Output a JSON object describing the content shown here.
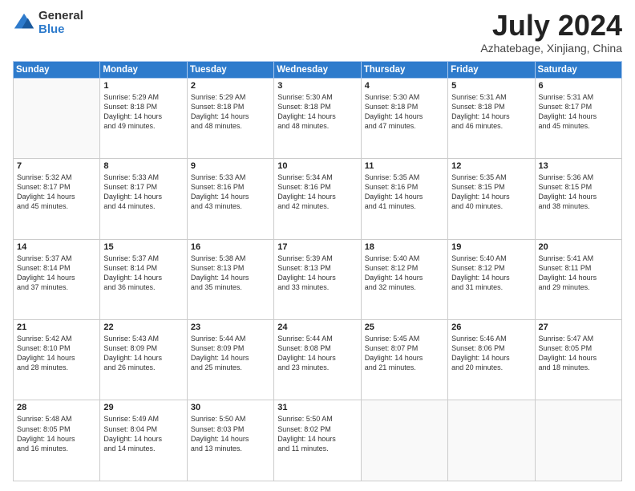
{
  "logo": {
    "general": "General",
    "blue": "Blue"
  },
  "title": {
    "month_year": "July 2024",
    "location": "Azhatebage, Xinjiang, China"
  },
  "weekdays": [
    "Sunday",
    "Monday",
    "Tuesday",
    "Wednesday",
    "Thursday",
    "Friday",
    "Saturday"
  ],
  "weeks": [
    [
      {
        "day": "",
        "info": ""
      },
      {
        "day": "1",
        "info": "Sunrise: 5:29 AM\nSunset: 8:18 PM\nDaylight: 14 hours\nand 49 minutes."
      },
      {
        "day": "2",
        "info": "Sunrise: 5:29 AM\nSunset: 8:18 PM\nDaylight: 14 hours\nand 48 minutes."
      },
      {
        "day": "3",
        "info": "Sunrise: 5:30 AM\nSunset: 8:18 PM\nDaylight: 14 hours\nand 48 minutes."
      },
      {
        "day": "4",
        "info": "Sunrise: 5:30 AM\nSunset: 8:18 PM\nDaylight: 14 hours\nand 47 minutes."
      },
      {
        "day": "5",
        "info": "Sunrise: 5:31 AM\nSunset: 8:18 PM\nDaylight: 14 hours\nand 46 minutes."
      },
      {
        "day": "6",
        "info": "Sunrise: 5:31 AM\nSunset: 8:17 PM\nDaylight: 14 hours\nand 45 minutes."
      }
    ],
    [
      {
        "day": "7",
        "info": "Sunrise: 5:32 AM\nSunset: 8:17 PM\nDaylight: 14 hours\nand 45 minutes."
      },
      {
        "day": "8",
        "info": "Sunrise: 5:33 AM\nSunset: 8:17 PM\nDaylight: 14 hours\nand 44 minutes."
      },
      {
        "day": "9",
        "info": "Sunrise: 5:33 AM\nSunset: 8:16 PM\nDaylight: 14 hours\nand 43 minutes."
      },
      {
        "day": "10",
        "info": "Sunrise: 5:34 AM\nSunset: 8:16 PM\nDaylight: 14 hours\nand 42 minutes."
      },
      {
        "day": "11",
        "info": "Sunrise: 5:35 AM\nSunset: 8:16 PM\nDaylight: 14 hours\nand 41 minutes."
      },
      {
        "day": "12",
        "info": "Sunrise: 5:35 AM\nSunset: 8:15 PM\nDaylight: 14 hours\nand 40 minutes."
      },
      {
        "day": "13",
        "info": "Sunrise: 5:36 AM\nSunset: 8:15 PM\nDaylight: 14 hours\nand 38 minutes."
      }
    ],
    [
      {
        "day": "14",
        "info": "Sunrise: 5:37 AM\nSunset: 8:14 PM\nDaylight: 14 hours\nand 37 minutes."
      },
      {
        "day": "15",
        "info": "Sunrise: 5:37 AM\nSunset: 8:14 PM\nDaylight: 14 hours\nand 36 minutes."
      },
      {
        "day": "16",
        "info": "Sunrise: 5:38 AM\nSunset: 8:13 PM\nDaylight: 14 hours\nand 35 minutes."
      },
      {
        "day": "17",
        "info": "Sunrise: 5:39 AM\nSunset: 8:13 PM\nDaylight: 14 hours\nand 33 minutes."
      },
      {
        "day": "18",
        "info": "Sunrise: 5:40 AM\nSunset: 8:12 PM\nDaylight: 14 hours\nand 32 minutes."
      },
      {
        "day": "19",
        "info": "Sunrise: 5:40 AM\nSunset: 8:12 PM\nDaylight: 14 hours\nand 31 minutes."
      },
      {
        "day": "20",
        "info": "Sunrise: 5:41 AM\nSunset: 8:11 PM\nDaylight: 14 hours\nand 29 minutes."
      }
    ],
    [
      {
        "day": "21",
        "info": "Sunrise: 5:42 AM\nSunset: 8:10 PM\nDaylight: 14 hours\nand 28 minutes."
      },
      {
        "day": "22",
        "info": "Sunrise: 5:43 AM\nSunset: 8:09 PM\nDaylight: 14 hours\nand 26 minutes."
      },
      {
        "day": "23",
        "info": "Sunrise: 5:44 AM\nSunset: 8:09 PM\nDaylight: 14 hours\nand 25 minutes."
      },
      {
        "day": "24",
        "info": "Sunrise: 5:44 AM\nSunset: 8:08 PM\nDaylight: 14 hours\nand 23 minutes."
      },
      {
        "day": "25",
        "info": "Sunrise: 5:45 AM\nSunset: 8:07 PM\nDaylight: 14 hours\nand 21 minutes."
      },
      {
        "day": "26",
        "info": "Sunrise: 5:46 AM\nSunset: 8:06 PM\nDaylight: 14 hours\nand 20 minutes."
      },
      {
        "day": "27",
        "info": "Sunrise: 5:47 AM\nSunset: 8:05 PM\nDaylight: 14 hours\nand 18 minutes."
      }
    ],
    [
      {
        "day": "28",
        "info": "Sunrise: 5:48 AM\nSunset: 8:05 PM\nDaylight: 14 hours\nand 16 minutes."
      },
      {
        "day": "29",
        "info": "Sunrise: 5:49 AM\nSunset: 8:04 PM\nDaylight: 14 hours\nand 14 minutes."
      },
      {
        "day": "30",
        "info": "Sunrise: 5:50 AM\nSunset: 8:03 PM\nDaylight: 14 hours\nand 13 minutes."
      },
      {
        "day": "31",
        "info": "Sunrise: 5:50 AM\nSunset: 8:02 PM\nDaylight: 14 hours\nand 11 minutes."
      },
      {
        "day": "",
        "info": ""
      },
      {
        "day": "",
        "info": ""
      },
      {
        "day": "",
        "info": ""
      }
    ]
  ]
}
